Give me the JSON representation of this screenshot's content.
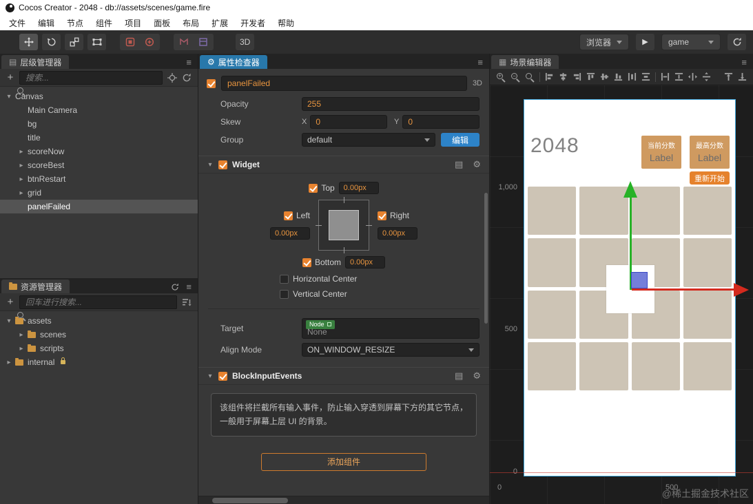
{
  "icons": {
    "gear": "⚙",
    "menu": "≡",
    "doc": "▤",
    "caret_down": "▾",
    "caret_right": "▸",
    "play": "▶",
    "plus": "+",
    "scene_tab": "▦",
    "list_tab": "▤"
  },
  "window": {
    "title": "Cocos Creator - 2048 - db://assets/scenes/game.fire"
  },
  "menu": {
    "items": [
      "文件",
      "编辑",
      "节点",
      "组件",
      "项目",
      "面板",
      "布局",
      "扩展",
      "开发者",
      "帮助"
    ]
  },
  "toolbar": {
    "mode_3d_label": "3D",
    "preview_browser_label": "浏览器",
    "device_value": "game"
  },
  "hierarchy": {
    "tab_label": "层级管理器",
    "search_placeholder": "搜索...",
    "nodes": [
      {
        "label": "Canvas"
      },
      {
        "label": "Main Camera"
      },
      {
        "label": "bg"
      },
      {
        "label": "title"
      },
      {
        "label": "scoreNow"
      },
      {
        "label": "scoreBest"
      },
      {
        "label": "btnRestart"
      },
      {
        "label": "grid"
      },
      {
        "label": "panelFailed"
      }
    ]
  },
  "assets": {
    "tab_label": "资源管理器",
    "search_placeholder": "回车进行搜索...",
    "items": [
      {
        "label": "assets"
      },
      {
        "label": "scenes"
      },
      {
        "label": "scripts"
      },
      {
        "label": "internal"
      }
    ]
  },
  "inspector": {
    "tab_label": "属性检查器",
    "node_name": "panelFailed",
    "mode_3d": "3D",
    "opacity": {
      "label": "Opacity",
      "value": "255"
    },
    "skew": {
      "label": "Skew",
      "x_label": "X",
      "x": "0",
      "y_label": "Y",
      "y": "0"
    },
    "group": {
      "label": "Group",
      "value": "default",
      "edit_label": "编辑"
    },
    "widget": {
      "title": "Widget",
      "top_label": "Top",
      "top_value": "0.00px",
      "left_label": "Left",
      "left_value": "0.00px",
      "right_label": "Right",
      "right_value": "0.00px",
      "bottom_label": "Bottom",
      "bottom_value": "0.00px",
      "h_center_label": "Horizontal Center",
      "v_center_label": "Vertical Center",
      "target_label": "Target",
      "target_type": "Node",
      "target_value": "None",
      "align_mode_label": "Align Mode",
      "align_mode_value": "ON_WINDOW_RESIZE"
    },
    "block_input": {
      "title": "BlockInputEvents",
      "description": "该组件将拦截所有输入事件，防止输入穿透到屏幕下方的其它节点，一般用于屏幕上层 UI 的背景。"
    },
    "add_component_label": "添加组件"
  },
  "scene": {
    "tab_label": "场景编辑器",
    "ruler": {
      "y_1000": "1,000",
      "y_500": "500",
      "y_0": "0",
      "x_0": "0",
      "x_500": "500"
    },
    "game": {
      "title": "2048",
      "score_now_caption": "当前分数",
      "score_now_value": "Label",
      "score_best_caption": "最高分数",
      "score_best_value": "Label",
      "restart_label": "重新开始"
    },
    "watermark": "@稀土掘金技术社区"
  }
}
